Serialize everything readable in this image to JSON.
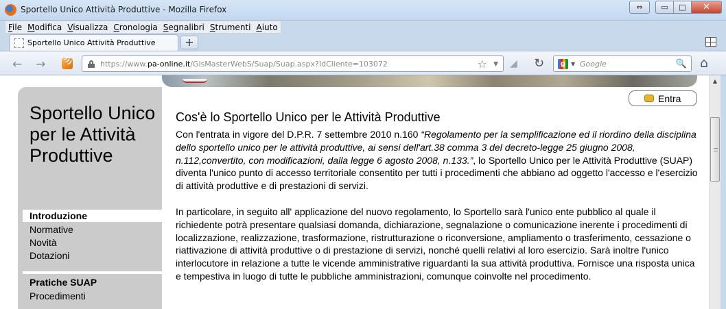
{
  "window": {
    "title": "Sportello Unico Attività Produttive - Mozilla Firefox",
    "controls": {
      "restore2": "⇔",
      "minimize": "▭",
      "maximize": "□",
      "close": "✕"
    }
  },
  "menubar": [
    {
      "label": "File",
      "underline": "F",
      "rest": "ile"
    },
    {
      "label": "Modifica",
      "underline": "M",
      "rest": "odifica"
    },
    {
      "label": "Visualizza",
      "underline": "V",
      "rest": "isualizza"
    },
    {
      "label": "Cronologia",
      "underline": "C",
      "rest": "ronologia"
    },
    {
      "label": "Segnalibri",
      "underline": "S",
      "rest": "egnalibri"
    },
    {
      "label": "Strumenti",
      "underline": "S",
      "rest": "trumenti"
    },
    {
      "label": "Aiuto",
      "underline": "A",
      "rest": "iuto"
    }
  ],
  "tabs": {
    "active_label": "Sportello Unico Attività Produttive",
    "new_tab": "+"
  },
  "navbar": {
    "back": "←",
    "forward": "→",
    "url_prefix": "https://www.",
    "url_domain": "pa-online.it",
    "url_path": "/GisMasterWebS/Suap/Suap.aspx?IdCliente=103072",
    "star": "☆",
    "drop": "▼",
    "feed": "◢",
    "reload": "↻",
    "search_placeholder": "Google",
    "search_engine_letter": "g",
    "search_drop": "▼",
    "magnifier": "🔍",
    "home": "⌂"
  },
  "page": {
    "sidebar_title": "Sportello Unico per le Attività Produttive",
    "nav_items": [
      {
        "label": "Introduzione",
        "active": true
      },
      {
        "label": "Normative"
      },
      {
        "label": "Novità"
      },
      {
        "label": "Dotazioni"
      }
    ],
    "section_header": "Pratiche SUAP",
    "section_items": [
      {
        "label": "Procedimenti"
      }
    ],
    "login_label": "Entra",
    "heading": "Cos'è lo Sportello Unico per le Attività Produttive",
    "p1_start": "Con l'entrata in vigore del D.P.R. 7 settembre 2010 n.160 ",
    "p1_italic": "“Regolamento per la semplificazione ed il riordino della disciplina dello sportello unico per le attività produttive, ai sensi dell'art.38 comma 3 del decreto-legge 25 giugno 2008, n.112,convertito, con modificazioni, dalla legge 6 agosto 2008, n.133.”",
    "p1_end": ", lo Sportello Unico per le Attività Produttive (SUAP) diventa l'unico punto di accesso territoriale consentito per tutti i procedimenti che abbiano ad oggetto l'accesso e l'esercizio di attività produttive e di prestazioni di servizi.",
    "p2": "In particolare, in seguito all' applicazione del nuovo regolamento, lo Sportello sarà l'unico ente pubblico al quale il richiedente potrà presentare qualsiasi domanda, dichiarazione, segnalazione o comunicazione inerente i procedimenti di localizzazione, realizzazione, trasformazione, ristrutturazione o riconversione, ampliamento o trasferimento, cessazione o riattivazione di attività produttive o di prestazione di servizi, nonché quelli relativi al loro esercizio. Sarà inoltre l'unico interlocutore in relazione a tutte le vicende amministrative riguardanti la sua attività produttiva. Fornisce una risposta unica e tempestiva in luogo di tutte le pubbliche amministrazioni, comunque coinvolte nel procedimento.",
    "scroll_up": "▲"
  }
}
